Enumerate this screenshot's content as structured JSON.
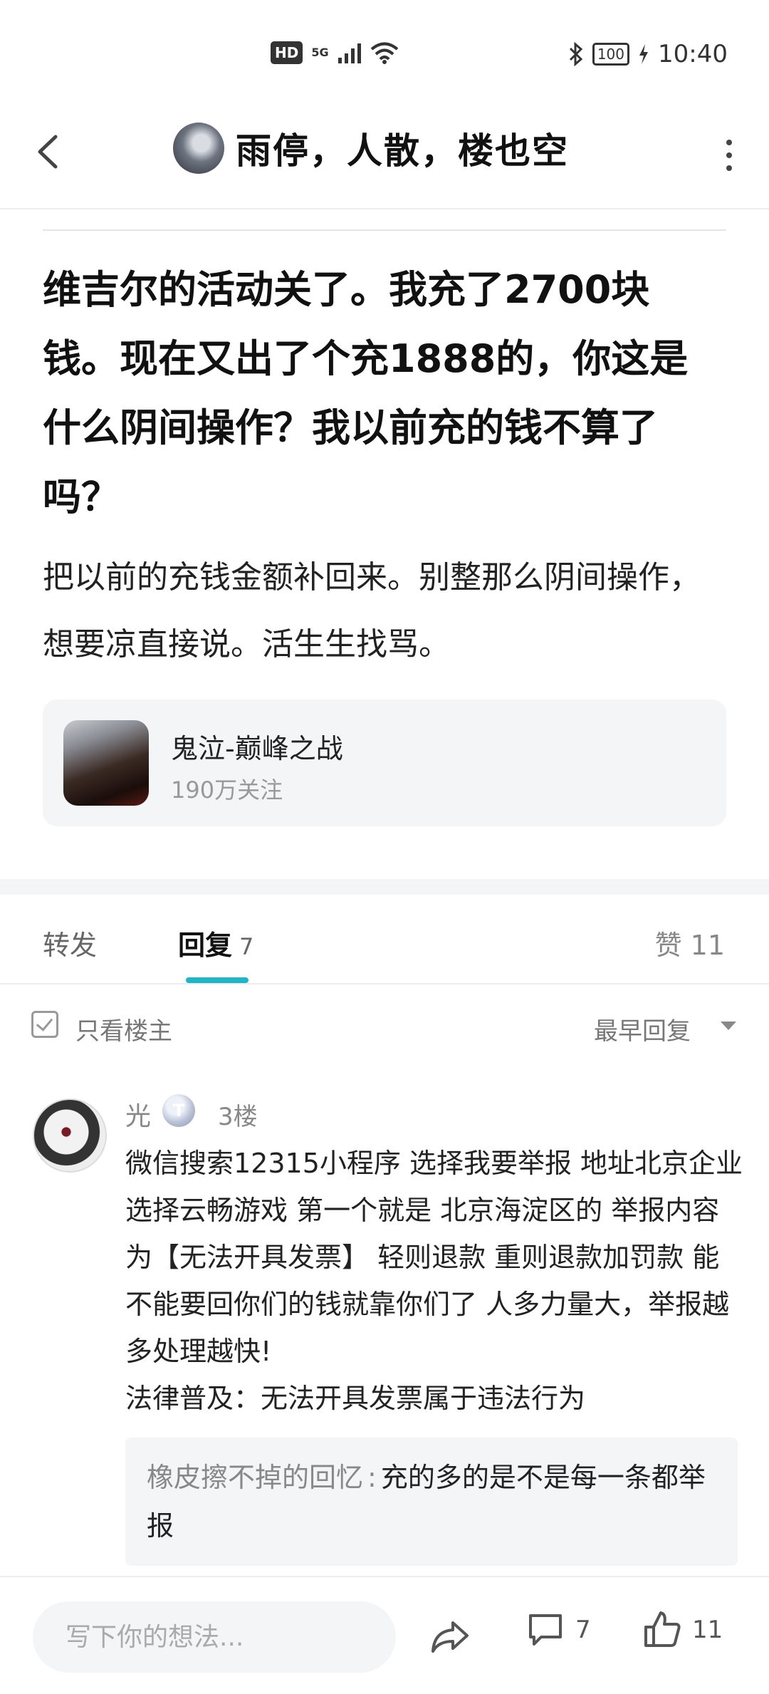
{
  "status_bar": {
    "network": "HD",
    "network_gen": "5G",
    "battery": "100",
    "time": "10:40"
  },
  "header": {
    "title": "雨停，人散，楼也空",
    "back_icon": "chevron-left-icon",
    "more_icon": "more-vertical-icon"
  },
  "post": {
    "title": "维吉尔的活动关了。我充了2700块钱。现在又出了个充1888的，你这是什么阴间操作？我以前充的钱不算了吗？",
    "body": "把以前的充钱金额补回来。别整那么阴间操作，想要凉直接说。活生生找骂。"
  },
  "game_card": {
    "name": "鬼泣-巅峰之战",
    "followers": "190万关注"
  },
  "tabs": {
    "forward": "转发",
    "reply": "回复",
    "reply_count": "7",
    "likes": "赞 11",
    "accent_color": "#1fb5c4"
  },
  "filter": {
    "only_op": "只看楼主",
    "sort": "最早回复"
  },
  "comment": {
    "author": "光",
    "badge": "T",
    "floor": "3楼",
    "text": "微信搜索12315小程序 选择我要举报 地址北京企业选择云畅游戏 第一个就是 北京海淀区的 举报内容为【无法开具发票】 轻则退款 重则退款加罚款 能不能要回你们的钱就靠你们了 人多力量大，举报越多处理越快!\n法律普及：无法开具发票属于违法行为",
    "sub_reply": {
      "author": "橡皮擦不掉的回忆",
      "separator": ":",
      "text": "充的多的是不是每一条都举报"
    }
  },
  "bottom_bar": {
    "placeholder": "写下你的想法...",
    "reply_count": "7",
    "like_count": "11"
  }
}
